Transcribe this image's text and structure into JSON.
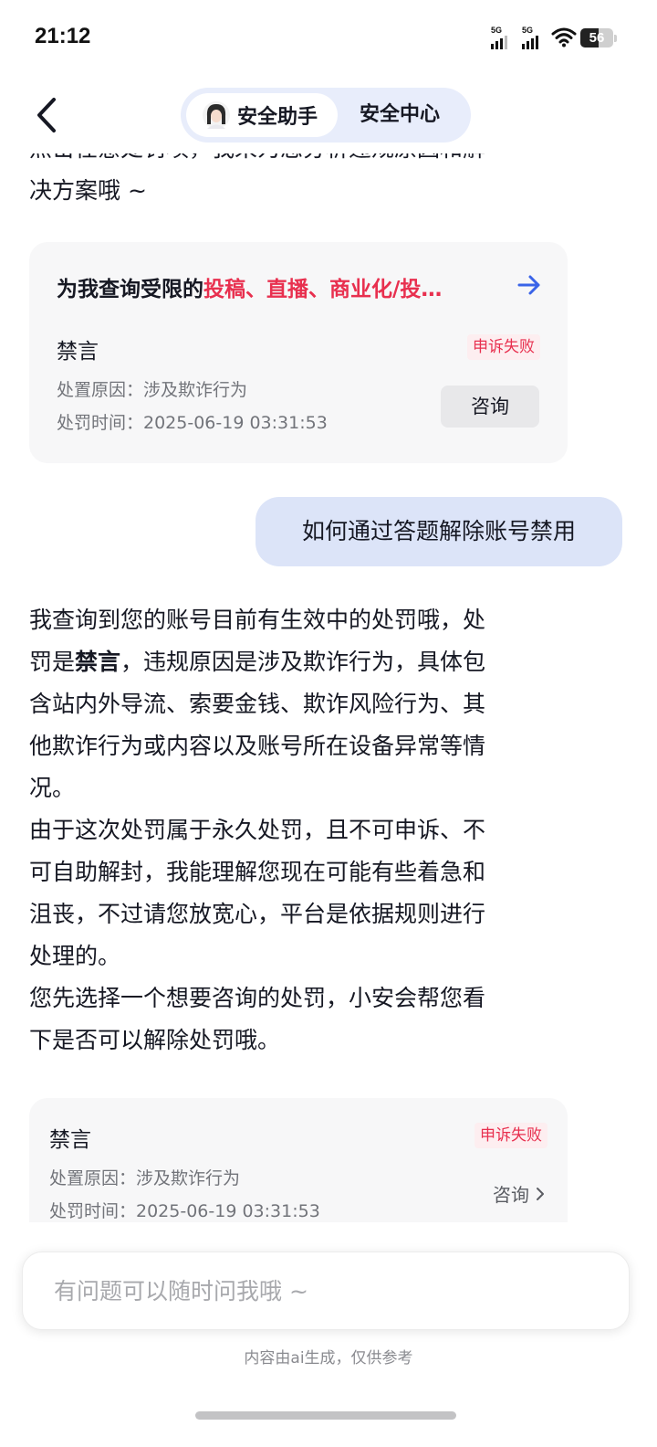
{
  "status_bar": {
    "time": "21:12",
    "signal1_label": "5G",
    "signal2_label": "5G",
    "battery": "56",
    "battery_level": 0.56
  },
  "header": {
    "tab_active": "安全助手",
    "tab_inactive": "安全中心"
  },
  "messages": {
    "ai_intro_line1": "点击任意处罚项，我来为您分析违规原因和解",
    "ai_intro_line2": "决方案哦 ~",
    "card1": {
      "query_prefix": "为我查询受限的",
      "query_highlight": "投稿、直播、商业化/投…",
      "penalty_type": "禁言",
      "status": "申诉失败",
      "reason": "处置原因：涉及欺诈行为",
      "time": "处罚时间：2025-06-19 03:31:53",
      "consult": "咨询"
    },
    "user_question": "如何通过答题解除账号禁用",
    "ai_reply": {
      "l1": "我查询到您的账号目前有生效中的处罚哦，处",
      "l2_pre": "罚是",
      "l2_bold": "禁言",
      "l2_post": "，违规原因是涉及欺诈行为，具体包",
      "l3": "含站内外导流、索要金钱、欺诈风险行为、其",
      "l4": "他欺诈行为或内容以及账号所在设备异常等情",
      "l5": "况。",
      "l6": "由于这次处罚属于永久处罚，且不可申诉、不",
      "l7": "可自助解封，我能理解您现在可能有些着急和",
      "l8": "沮丧，不过请您放宽心，平台是依据规则进行",
      "l9": "处理的。",
      "l10": "您先选择一个想要咨询的处罚，小安会帮您看",
      "l11": "下是否可以解除处罚哦。"
    },
    "card2": {
      "penalty_type": "禁言",
      "status": "申诉失败",
      "reason": "处置原因：涉及欺诈行为",
      "time": "处罚时间：2025-06-19 03:31:53",
      "consult": "咨询"
    }
  },
  "input": {
    "placeholder": "有问题可以随时问我哦 ~"
  },
  "footer": {
    "disclaimer": "内容由ai生成，仅供参考"
  }
}
